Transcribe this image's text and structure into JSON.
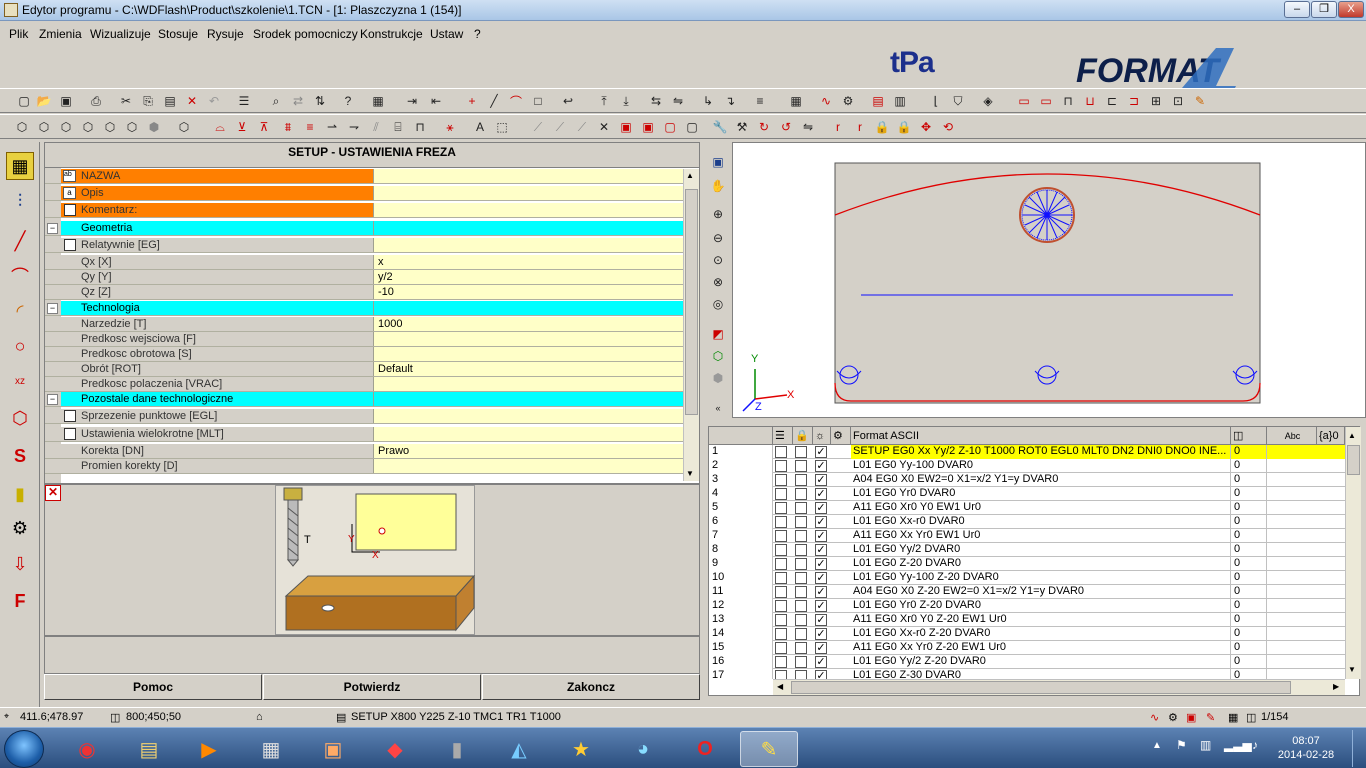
{
  "window": {
    "title": "Edytor programu - C:\\WDFlash\\Product\\szkolenie\\1.TCN - [1: Plaszczyzna 1 (154)]",
    "min_label": "–",
    "max_label": "❐",
    "close_label": "X"
  },
  "menu": [
    {
      "label": "Plik"
    },
    {
      "label": "Zmienia"
    },
    {
      "label": "Wizualizuje"
    },
    {
      "label": "Stosuje"
    },
    {
      "label": "Rysuje"
    },
    {
      "label": "Srodek pomocniczy"
    },
    {
      "label": "Konstrukcje"
    },
    {
      "label": "Ustaw"
    },
    {
      "label": "?"
    }
  ],
  "logos": {
    "tpa": "tPa",
    "format": "FORMAT",
    "four": "4"
  },
  "setup": {
    "header": "SETUP - USTAWIENIA FREZA",
    "rows": [
      {
        "label": "NAZWA",
        "value": "",
        "style": "orange"
      },
      {
        "label": "Opis",
        "value": "",
        "style": "orange"
      },
      {
        "label": "Komentarz:",
        "value": "",
        "style": "orange"
      },
      {
        "label": "Geometria",
        "value": "",
        "style": "cyan"
      },
      {
        "label": "Relatywnie [EG]",
        "value": "",
        "style": "grey"
      },
      {
        "label": "Qx [X]",
        "value": "x",
        "style": "grey"
      },
      {
        "label": "Qy [Y]",
        "value": "y/2",
        "style": "grey"
      },
      {
        "label": "Qz [Z]",
        "value": "-10",
        "style": "grey"
      },
      {
        "label": "Technologia",
        "value": "",
        "style": "cyan"
      },
      {
        "label": "Narzedzie [T]",
        "value": "1000",
        "style": "grey"
      },
      {
        "label": "Predkosc wejsciowa [F]",
        "value": "",
        "style": "grey"
      },
      {
        "label": "Predkosc obrotowa [S]",
        "value": "",
        "style": "grey"
      },
      {
        "label": "Obrót [ROT]",
        "value": "Default",
        "style": "grey"
      },
      {
        "label": "Predkosc polaczenia [VRAC]",
        "value": "",
        "style": "grey"
      },
      {
        "label": "Pozostale dane technologiczne",
        "value": "",
        "style": "cyan"
      },
      {
        "label": "Sprzezenie punktowe [EGL]",
        "value": "",
        "style": "grey"
      },
      {
        "label": "Ustawienia wielokrotne [MLT]",
        "value": "",
        "style": "grey"
      },
      {
        "label": "Korekta [DN]",
        "value": "Prawo",
        "style": "grey"
      },
      {
        "label": "Promien korekty [D]",
        "value": "",
        "style": "grey"
      }
    ],
    "preview_tool_label": "T",
    "preview_y_label": "Y",
    "preview_x_label": "X"
  },
  "buttons": {
    "help": "Pomoc",
    "confirm": "Potwierdz",
    "finish": "Zakoncz"
  },
  "view": {
    "axis_y": "Y",
    "axis_x": "X",
    "axis_z": "Z"
  },
  "grid": {
    "headers": {
      "format": "Format ASCII",
      "abc": "Abc",
      "a0": "{a}0"
    },
    "rows": [
      {
        "n": "1",
        "code": "SETUP EG0 Xx Yy/2 Z-10 T1000 ROT0 EGL0 MLT0 DN2 DNI0 DNO0 INE...",
        "z": "0"
      },
      {
        "n": "2",
        "code": "L01 EG0 Yy-100 DVAR0",
        "z": "0"
      },
      {
        "n": "3",
        "code": "A04 EG0 X0 EW2=0 X1=x/2 Y1=y DVAR0",
        "z": "0"
      },
      {
        "n": "4",
        "code": "L01 EG0 Yr0 DVAR0",
        "z": "0"
      },
      {
        "n": "5",
        "code": "A11 EG0 Xr0 Y0 EW1 Ur0",
        "z": "0"
      },
      {
        "n": "6",
        "code": "L01 EG0 Xx-r0 DVAR0",
        "z": "0"
      },
      {
        "n": "7",
        "code": "A11 EG0 Xx Yr0 EW1 Ur0",
        "z": "0"
      },
      {
        "n": "8",
        "code": "L01 EG0 Yy/2 DVAR0",
        "z": "0"
      },
      {
        "n": "9",
        "code": "L01 EG0 Z-20 DVAR0",
        "z": "0"
      },
      {
        "n": "10",
        "code": "L01 EG0 Yy-100 Z-20 DVAR0",
        "z": "0"
      },
      {
        "n": "11",
        "code": "A04 EG0 X0 Z-20 EW2=0 X1=x/2 Y1=y DVAR0",
        "z": "0"
      },
      {
        "n": "12",
        "code": "L01 EG0 Yr0 Z-20 DVAR0",
        "z": "0"
      },
      {
        "n": "13",
        "code": "A11 EG0 Xr0 Y0 Z-20 EW1 Ur0",
        "z": "0"
      },
      {
        "n": "14",
        "code": "L01 EG0 Xx-r0 Z-20 DVAR0",
        "z": "0"
      },
      {
        "n": "15",
        "code": "A11 EG0 Xx Yr0 Z-20 EW1 Ur0",
        "z": "0"
      },
      {
        "n": "16",
        "code": "L01 EG0 Yy/2 Z-20 DVAR0",
        "z": "0"
      },
      {
        "n": "17",
        "code": "L01 EG0 Z-30 DVAR0",
        "z": "0"
      }
    ]
  },
  "status": {
    "coords": "411.6;478.97",
    "dims": "800;450;50",
    "setup": "SETUP X800 Y225 Z-10 TMC1 TR1 T1000",
    "page": "1/154"
  },
  "taskbar": {
    "time": "08:07",
    "date": "2014-02-28"
  },
  "colors": {
    "accent_orange": "#ff7f00",
    "accent_cyan": "#00ffff",
    "selected_row": "#ffff00",
    "cell_bg": "#ffffc8"
  }
}
